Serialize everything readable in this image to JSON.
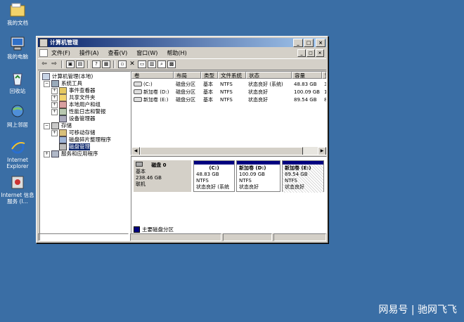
{
  "desktop": {
    "icons": [
      {
        "label": "我的文档"
      },
      {
        "label": "我的电脑"
      },
      {
        "label": "回收站"
      },
      {
        "label": "网上邻居"
      },
      {
        "label": "Internet Explorer"
      },
      {
        "label": "Internet 信息服务 (I..."
      }
    ]
  },
  "window": {
    "title": "计算机管理",
    "caption_min": "_",
    "caption_max": "□",
    "caption_close": "×"
  },
  "menu": {
    "items": [
      "文件(F)",
      "操作(A)",
      "查看(V)",
      "窗口(W)",
      "帮助(H)"
    ]
  },
  "tree": {
    "root": "计算机管理(本地)",
    "system_tools": "系统工具",
    "event_viewer": "事件查看器",
    "shared_folders": "共享文件夹",
    "local_users": "本地用户和组",
    "perf_logs": "性能日志和警报",
    "device_manager": "设备管理器",
    "storage": "存储",
    "removable": "可移动存储",
    "defrag": "磁盘碎片整理程序",
    "disk_mgmt": "磁盘管理",
    "services_apps": "服务和应用程序"
  },
  "volume_list": {
    "columns": [
      "卷",
      "布局",
      "类型",
      "文件系统",
      "状态",
      "容量",
      "空"
    ],
    "rows": [
      {
        "vol": "(C:)",
        "layout": "磁盘分区",
        "type": "基本",
        "fs": "NTFS",
        "status": "状态良好 (系统)",
        "capacity": "48.83 GB",
        "free": "3"
      },
      {
        "vol": "新加卷 (D:)",
        "layout": "磁盘分区",
        "type": "基本",
        "fs": "NTFS",
        "status": "状态良好",
        "capacity": "100.09 GB",
        "free": "1"
      },
      {
        "vol": "新加卷 (E:)",
        "layout": "磁盘分区",
        "type": "基本",
        "fs": "NTFS",
        "status": "状态良好",
        "capacity": "89.54 GB",
        "free": "8"
      }
    ]
  },
  "disk": {
    "name": "磁盘 0",
    "type": "基本",
    "size": "238.46 GB",
    "state": "联机",
    "partitions": [
      {
        "name": "(C:)",
        "size": "48.83 GB NTFS",
        "status": "状态良好 (系统"
      },
      {
        "name": "新加卷  (D:)",
        "size": "100.09 GB NTFS",
        "status": "状态良好"
      },
      {
        "name": "新加卷  (E:)",
        "size": "89.54 GB NTFS",
        "status": "状态良好"
      }
    ]
  },
  "legend": {
    "primary": "主要磁盘分区"
  },
  "watermark": "网易号 | 驰网飞飞"
}
